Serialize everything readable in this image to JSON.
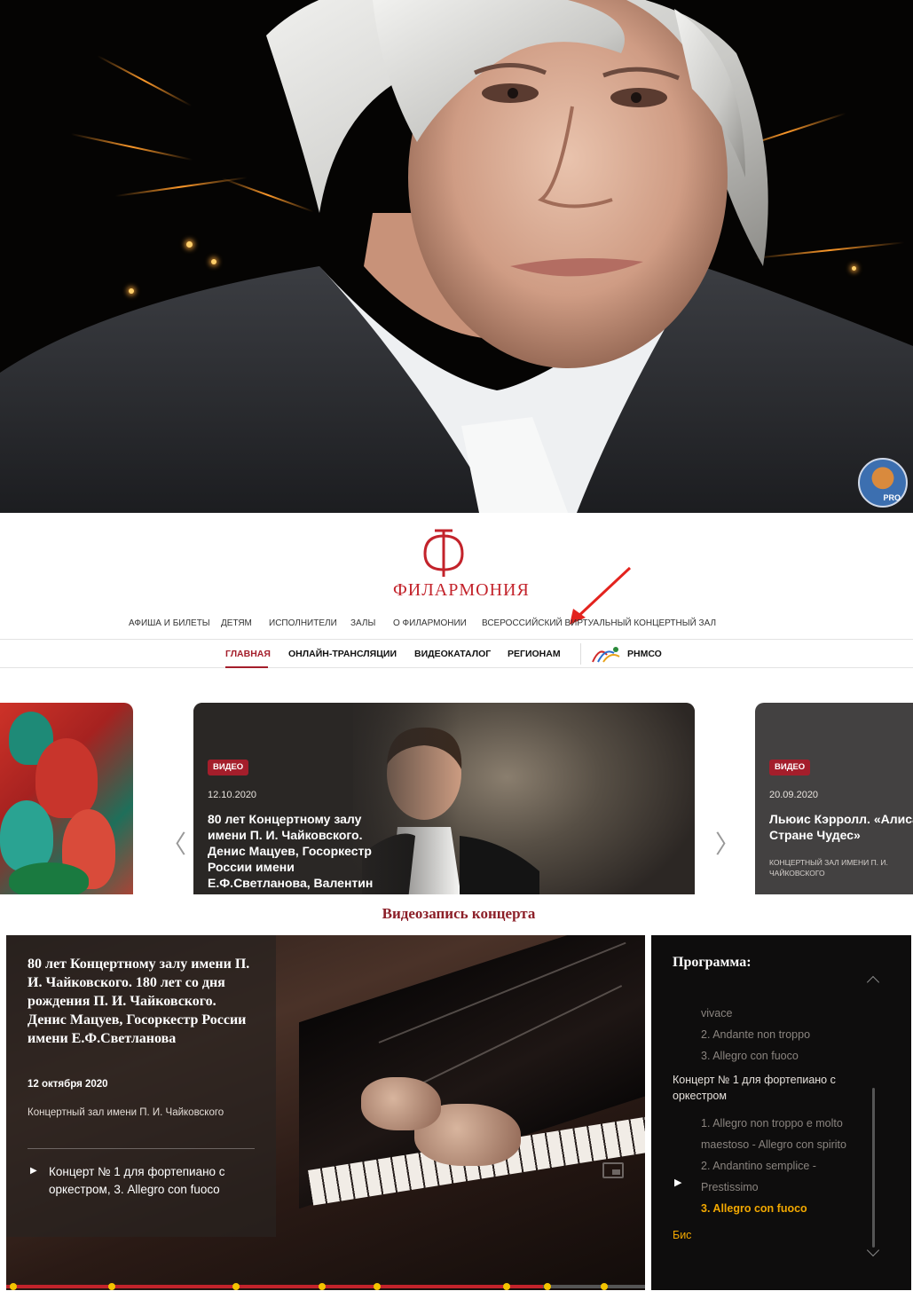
{
  "hero": {
    "badge_text": "PRO",
    "badge_icon": "cat-avatar-icon"
  },
  "site": {
    "logo_text": "ФИЛАРМОНИЯ",
    "top_nav": [
      "АФИША И БИЛЕТЫ",
      "ДЕТЯМ",
      "ИСПОЛНИТЕЛИ",
      "ЗАЛЫ",
      "О ФИЛАРМОНИИ",
      "ВСЕРОССИЙСКИЙ ВИРТУАЛЬНЫЙ КОНЦЕРТНЫЙ ЗАЛ"
    ],
    "sub_nav": [
      "ГЛАВНАЯ",
      "ОНЛАЙН-ТРАНСЛЯЦИИ",
      "ВИДЕОКАТАЛОГ",
      "РЕГИОНАМ",
      "РНМСО"
    ],
    "active_sub_nav": "ГЛАВНАЯ",
    "accent_color": "#a41e2b"
  },
  "carousel": {
    "prev_arrow": "〈",
    "next_arrow": "〉",
    "main_card": {
      "badge": "ВИДЕО",
      "date": "12.10.2020",
      "title": "80 лет Концертному залу имени П. И. Чайковского. Денис Мацуев, Госоркестр России имени Е.Ф.Светланова, Валентин Урюпин"
    },
    "right_card": {
      "badge": "ВИДЕО",
      "date": "20.09.2020",
      "title": "Льюис Кэрролл. «Алиса в Стране Чудес»",
      "venue": "КОНЦЕРТНЫЙ ЗАЛ ИМЕНИ П. И. ЧАЙКОВСКОГО"
    }
  },
  "video": {
    "heading": "Видеозапись концерта",
    "concert_title": "80 лет Концертному залу имени П. И. Чайковского. 180 лет со дня рождения П. И. Чайковского. Денис Мацуев, Госоркестр России имени Е.Ф.Светланова",
    "concert_date": "12 октября 2020",
    "venue": "Концертный зал имени П. И. Чайковского",
    "now_playing": "Концерт № 1 для фортепиано с оркестром, 3. Allegro con fuoco",
    "progress_fraction": 0.84
  },
  "program": {
    "title": "Программа:",
    "items": [
      {
        "text": "vivace",
        "type": "sub"
      },
      {
        "text": "2. Andante non troppo",
        "type": "sub"
      },
      {
        "text": "3. Allegro con fuoco",
        "type": "sub"
      },
      {
        "text": "Концерт № 1 для фортепиано с оркестром",
        "type": "head"
      },
      {
        "text": "1. Allegro non troppo e molto maestoso - Allegro con spirito",
        "type": "sub"
      },
      {
        "text": "2. Andantino semplice - Prestissimo",
        "type": "sub"
      },
      {
        "text": "3. Allegro con fuoco",
        "type": "current"
      },
      {
        "text": "Бис",
        "type": "bis"
      }
    ]
  }
}
